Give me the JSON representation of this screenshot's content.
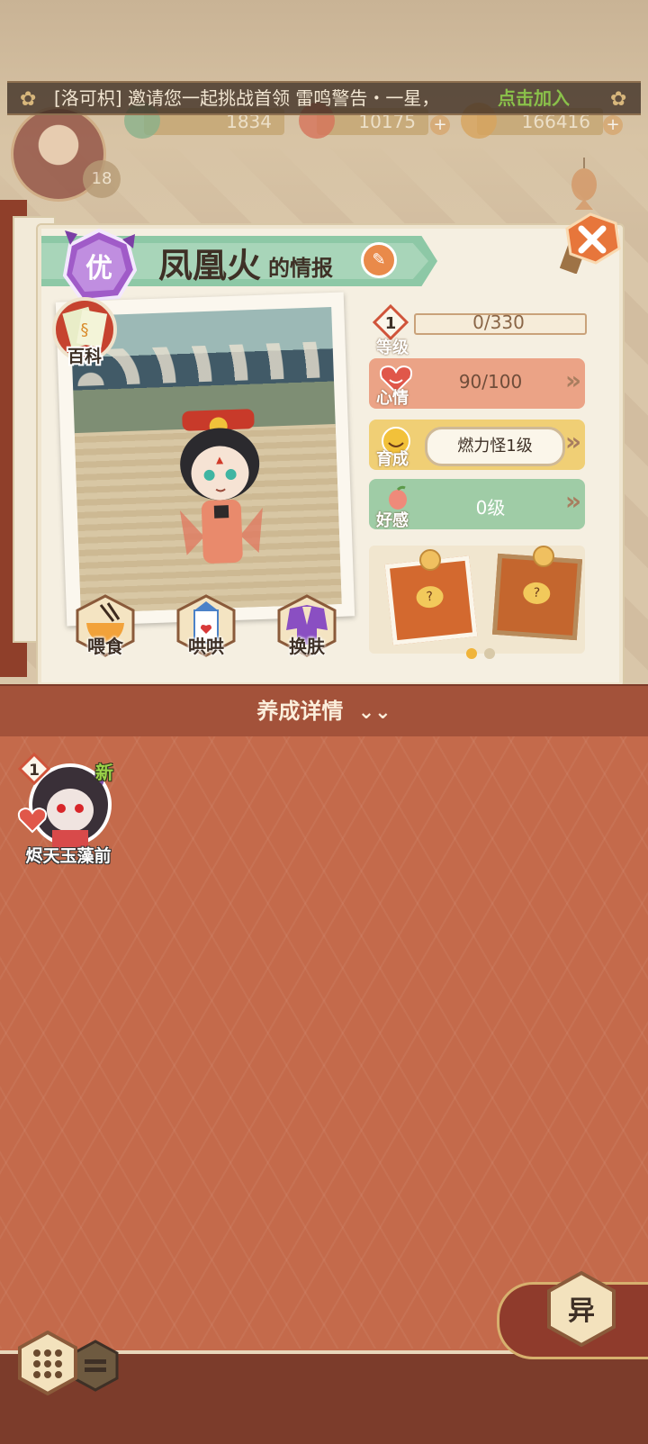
{
  "banner": {
    "text": "[洛可枳] 邀请您一起挑战首领 雷鸣警告・一星，",
    "join_label": "点击加入"
  },
  "currencies": [
    {
      "icon": "jade-icon",
      "value": "1834"
    },
    {
      "icon": "stamina-icon",
      "value": "10175"
    },
    {
      "icon": "coin-icon",
      "value": "166416"
    }
  ],
  "player": {
    "level": "18"
  },
  "pet_info": {
    "grade_label": "优",
    "name": "凤凰火",
    "title_suffix": "的情报",
    "wiki_label": "百科",
    "actions": [
      {
        "label": "喂食",
        "icon": "ramen-bowl-icon"
      },
      {
        "label": "哄哄",
        "icon": "milk-carton-icon"
      },
      {
        "label": "换肤",
        "icon": "kimono-icon"
      }
    ],
    "level": {
      "label": "等级",
      "value": "1",
      "xp": "0/330",
      "xp_fraction": 0
    },
    "mood": {
      "label": "心情",
      "value": "90/100"
    },
    "growth": {
      "label": "育成",
      "value": "燃力怪1级"
    },
    "affection": {
      "label": "好感",
      "value": "0级"
    },
    "page_indicator": {
      "count": 2,
      "active": 0
    }
  },
  "section": {
    "title": "养成详情"
  },
  "pet_list": [
    {
      "name": "烬天玉藻前",
      "level": "1",
      "badge": "新"
    }
  ],
  "bottom": {
    "mode_button_label": "异"
  },
  "colors": {
    "panel": "#f5efe1",
    "ribbon": "#8dc8a6",
    "mood": "#eba386",
    "growth": "#f0cf75",
    "affection": "#9fcca6",
    "list_bg": "#c46a4b",
    "section_header": "#a3523a",
    "new_badge": "#9bd34a",
    "join_link": "#8ac04a"
  }
}
